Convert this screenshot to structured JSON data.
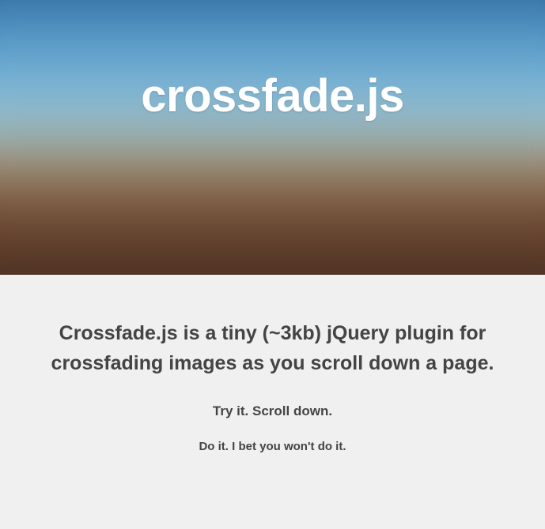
{
  "hero": {
    "title": "crossfade.js"
  },
  "content": {
    "headline": "Crossfade.js is a tiny (~3kb) jQuery plugin for crossfading images as you scroll down a page.",
    "sub1": "Try it. Scroll down.",
    "sub2": "Do it. I bet you won't do it."
  }
}
